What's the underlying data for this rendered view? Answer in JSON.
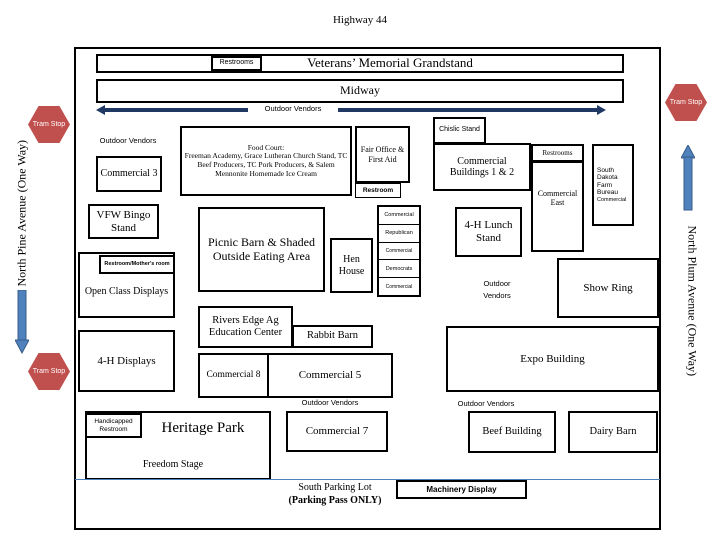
{
  "title": "Highway 44",
  "grandstand": {
    "label": "Veterans’ Memorial Grandstand",
    "restrooms": "Restrooms"
  },
  "midway": "Midway",
  "outdoor_vendors": "Outdoor Vendors",
  "commercial3": "Commercial 3",
  "food_court": {
    "heading": "Food Court:",
    "text": "Freeman Academy, Grace Lutheran Church Stand, TC Beef Producers, TC Pork Producers, & Salem Mennonite Homemade Ice Cream"
  },
  "fair_office": "Fair Office & First Aid",
  "restroom": "Restroom",
  "chislic": "Chislic Stand",
  "commercial_buildings": "Commercial Buildings 1 & 2",
  "restrooms_east": "Restrooms",
  "commercial_east": "Commercial East",
  "sd_farm_bureau": {
    "name": "South Dakota Farm Bureau",
    "sub": "Commercial"
  },
  "vfw": "VFW Bingo Stand",
  "picnic_barn": "Picnic Barn & Shaded Outside Eating Area",
  "hen_house": "Hen House",
  "booths": [
    "Commercial",
    "Republican",
    "Commercial",
    "Democrats",
    "Commercial"
  ],
  "lunch_stand": "4-H Lunch Stand",
  "outdoor_vendors_2": "Outdoor Vendors",
  "open_class": "Open Class Displays",
  "mothers_room": "Restroom/Mother's room",
  "show_ring": "Show Ring",
  "rivers_edge": "Rivers Edge Ag Education Center",
  "rabbit_barn": "Rabbit Barn",
  "displays_4h": "4-H Displays",
  "commercial8": "Commercial 8",
  "commercial5": "Commercial 5",
  "expo": "Expo Building",
  "handicapped": "Handicapped Restroom",
  "heritage_park": "Heritage Park",
  "freedom_stage": "Freedom Stage",
  "commercial7": "Commercial 7",
  "beef": "Beef Building",
  "dairy": "Dairy Barn",
  "parking": {
    "line1": "South Parking Lot",
    "line2": "(Parking Pass ONLY)"
  },
  "machinery": "Machinery Display",
  "tram_stop": "Tram Stop",
  "north_pine": "North Pine Avenue (One Way)",
  "north_plum": "North Plum Avenue (One Way)",
  "colors": {
    "tram": "#c0504d",
    "arrow": "#4f81bd",
    "line": "#1f3864"
  }
}
